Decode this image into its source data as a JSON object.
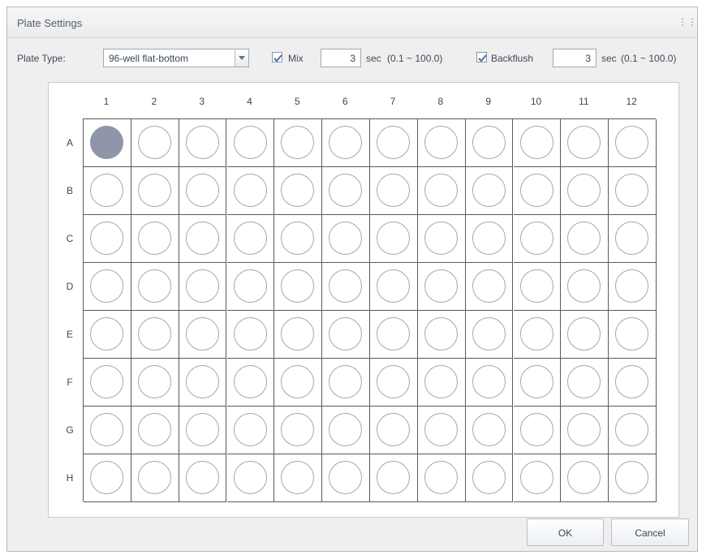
{
  "dialog": {
    "title": "Plate Settings",
    "title_icon": "grid-icon"
  },
  "toolbar": {
    "plate_type_label": "Plate Type:",
    "plate_type_value": "96-well flat-bottom",
    "mix_label": "Mix",
    "mix_checked": true,
    "mix_value": "3",
    "mix_unit": "sec",
    "mix_range": "(0.1 ~ 100.0)",
    "backflush_label": "Backflush",
    "backflush_checked": true,
    "backflush_value": "3",
    "backflush_unit": "sec",
    "backflush_range": "(0.1 ~ 100.0)"
  },
  "plate": {
    "columns": [
      "1",
      "2",
      "3",
      "4",
      "5",
      "6",
      "7",
      "8",
      "9",
      "10",
      "11",
      "12"
    ],
    "rows": [
      "A",
      "B",
      "C",
      "D",
      "E",
      "F",
      "G",
      "H"
    ],
    "selected_wells": [
      "A1"
    ],
    "selected_color": "#8f96aa"
  },
  "buttons": {
    "ok": "OK",
    "cancel": "Cancel"
  }
}
